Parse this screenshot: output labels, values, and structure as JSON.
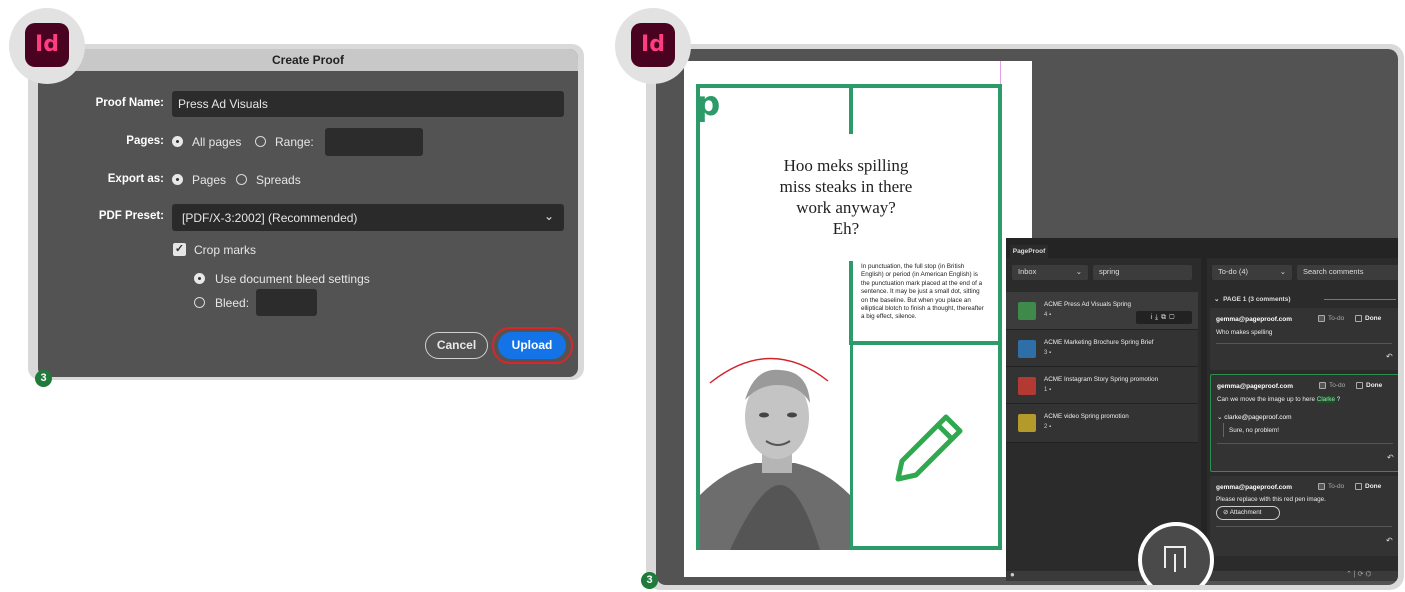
{
  "dialog": {
    "title": "Create Proof",
    "proof_name_label": "Proof Name:",
    "proof_name_value": "Press Ad Visuals",
    "pages_label": "Pages:",
    "all_pages": "All pages",
    "range": "Range:",
    "export_label": "Export as:",
    "export_pages": "Pages",
    "export_spreads": "Spreads",
    "preset_label": "PDF Preset:",
    "preset_value": "[PDF/X-3:2002] (Recommended)",
    "crop_marks": "Crop marks",
    "use_bleed": "Use document bleed settings",
    "bleed": "Bleed:",
    "cancel": "Cancel",
    "upload": "Upload",
    "upload_highlight_color": "#d9262a",
    "upload_color": "#1473e6"
  },
  "badges": {
    "app_icon": "Id",
    "step_left": "3",
    "step_right": "3"
  },
  "document": {
    "logo": "p",
    "headline": [
      "Hoo meks spilling",
      "miss steaks in there",
      "work anyway?",
      "Eh?"
    ],
    "body": "In punctuation, the full stop (in British English) or period (in American English) is the punctuation mark placed at the end of a sentence. It may be just a small dot, sitting on the baseline. But when you place an elliptical blotch to finish a thought, thereafter a big effect, silence.",
    "accent_color": "#2d9a6a"
  },
  "pageproof": {
    "tab": "PageProof",
    "inbox": "Inbox",
    "search_value": "spring",
    "todo_filter": "To-do (4)",
    "search_comments": "Search comments",
    "proofs": [
      {
        "title": "ACME Press Ad Visuals Spring",
        "count": "4",
        "color": "#3f8a4a"
      },
      {
        "title": "ACME Marketing Brochure Spring Brief",
        "count": "3",
        "color": "#2f6fa8"
      },
      {
        "title": "ACME Instagram Story Spring promotion",
        "count": "1",
        "color": "#b33a32"
      },
      {
        "title": "ACME video Spring promotion",
        "count": "2",
        "color": "#b39a2a"
      }
    ],
    "page_header": "PAGE 1 (3 comments)",
    "todo": "To-do",
    "done": "Done",
    "comments": [
      {
        "author": "gemma@pageproof.com",
        "text": "Who makes spelling"
      },
      {
        "author": "gemma@pageproof.com",
        "text_before": "Can we move the image up to here ",
        "mention": "Clarke",
        "text_after": " ?",
        "reply_author": "clarke@pageproof.com",
        "reply_text": "Sure, no problem!"
      },
      {
        "author": "gemma@pageproof.com",
        "text": "Please replace with this red pen image.",
        "attachment": "Attachment"
      }
    ]
  }
}
